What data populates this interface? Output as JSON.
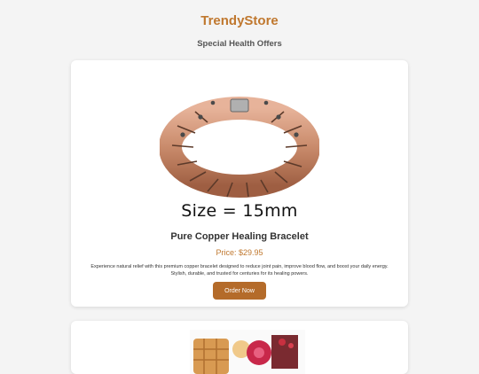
{
  "store": {
    "name": "TrendyStore",
    "subtitle": "Special Health Offers"
  },
  "products": [
    {
      "image_caption": "Size = 15mm",
      "title": "Pure Copper Healing Bracelet",
      "price": "Price: $29.95",
      "description": "Experience natural relief with this premium copper bracelet designed to reduce joint pain, improve blood flow, and boost your daily energy. Stylish, durable, and trusted for centuries for its healing powers.",
      "button_label": "Order Now"
    }
  ],
  "colors": {
    "accent": "#c0782f",
    "button": "#b46b2a",
    "background": "#f4f4f4",
    "copper": "#c98b6b"
  }
}
